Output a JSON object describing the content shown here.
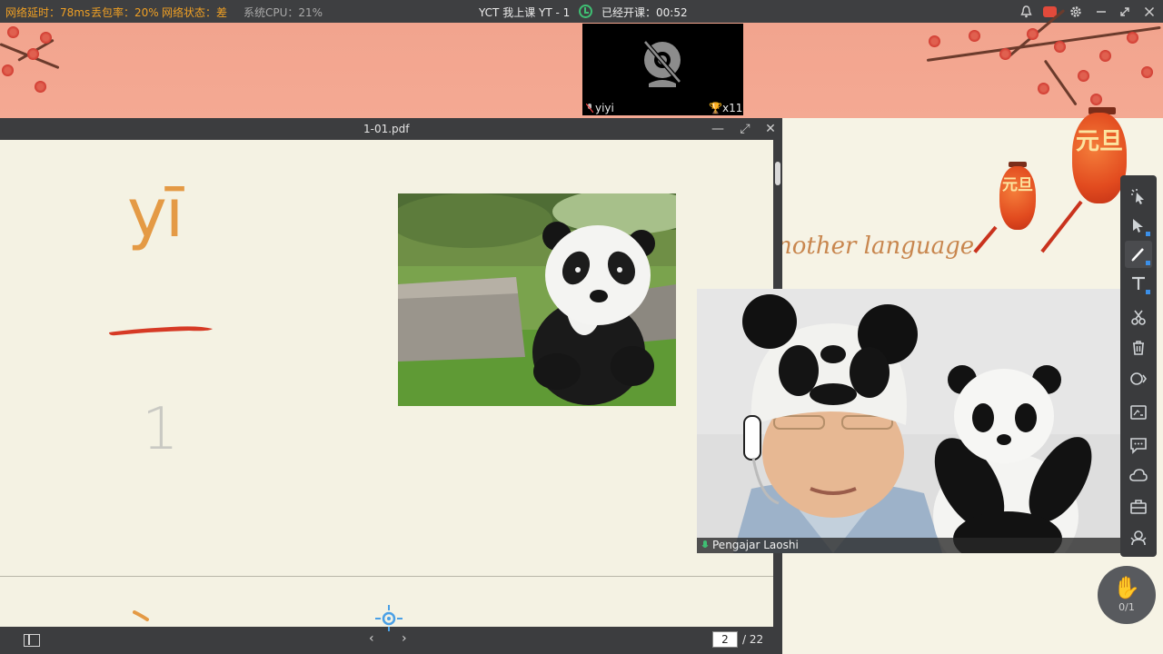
{
  "statusbar": {
    "latency_label": "网络延时：",
    "latency_value": "78ms",
    "loss_label": "丢包率：",
    "loss_value": "20%",
    "network_label": "网络状态：",
    "network_value": "差",
    "cpu_label": "系统CPU：",
    "cpu_value": "21%",
    "class_title": "YCT 我上课 YT - 1",
    "timer_label": "已经开课：",
    "timer_value": "00:52",
    "icons": [
      "bell-icon",
      "record-icon",
      "settings-icon",
      "minimize-icon",
      "restore-icon",
      "close-icon"
    ]
  },
  "background_slide": {
    "subtitle": "nother language",
    "lantern_text_large": "元旦",
    "lantern_text_small": "元旦"
  },
  "camera_tile": {
    "student_name": "yiyi",
    "trophy_count": "x11",
    "camera_state": "camera-off-icon"
  },
  "pdf_viewer": {
    "file_name": "1-01.pdf",
    "pinyin": "yī",
    "numeral": "1",
    "current_page": "2",
    "total_pages": "/ 22",
    "stroke_color": "#d63a25"
  },
  "teacher_video": {
    "name": "Pengajar Laoshi"
  },
  "toolbar": {
    "tools": [
      "pointer-icon",
      "select-icon",
      "pen-icon",
      "text-icon",
      "scissors-icon",
      "trash-icon",
      "shape-icon",
      "whiteboard-icon",
      "chat-icon",
      "cloud-icon",
      "toolbox-icon",
      "users-icon"
    ]
  },
  "hand_raise": {
    "count": "0/1"
  },
  "colors": {
    "topbar": "#3e3f41",
    "warning": "#f0a024",
    "header_salmon": "#f2a48e",
    "pinyin_orange": "#e49a45",
    "accent_blue": "#3b8fe8"
  }
}
